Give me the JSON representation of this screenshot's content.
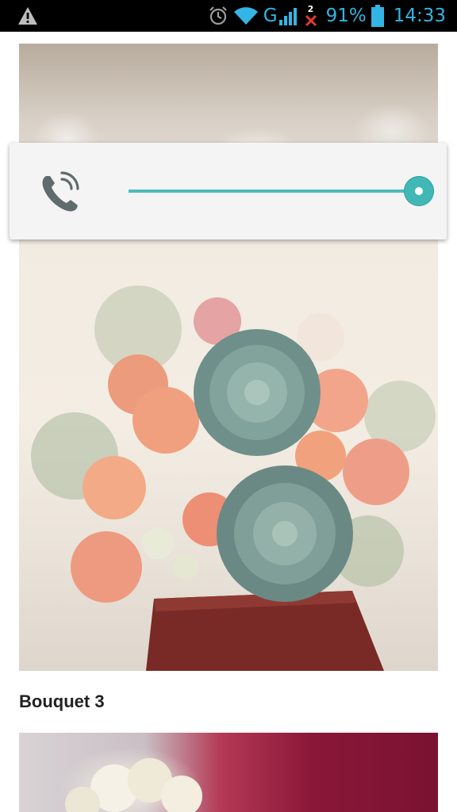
{
  "status_bar": {
    "network_type": "G",
    "sim_badge": "2",
    "battery_percent": "91%",
    "battery_level": 0.91,
    "time": "14:33",
    "accent_color": "#33b5e5",
    "icons": [
      "warning-icon",
      "alarm-icon",
      "wifi-icon",
      "signal-icon",
      "sim2-no-signal-icon",
      "battery-icon"
    ]
  },
  "volume_panel": {
    "stream_icon": "call-volume-icon",
    "level": 1.0,
    "accent_color": "#4cbcbb"
  },
  "gallery": {
    "caption": "Bouquet 3"
  }
}
